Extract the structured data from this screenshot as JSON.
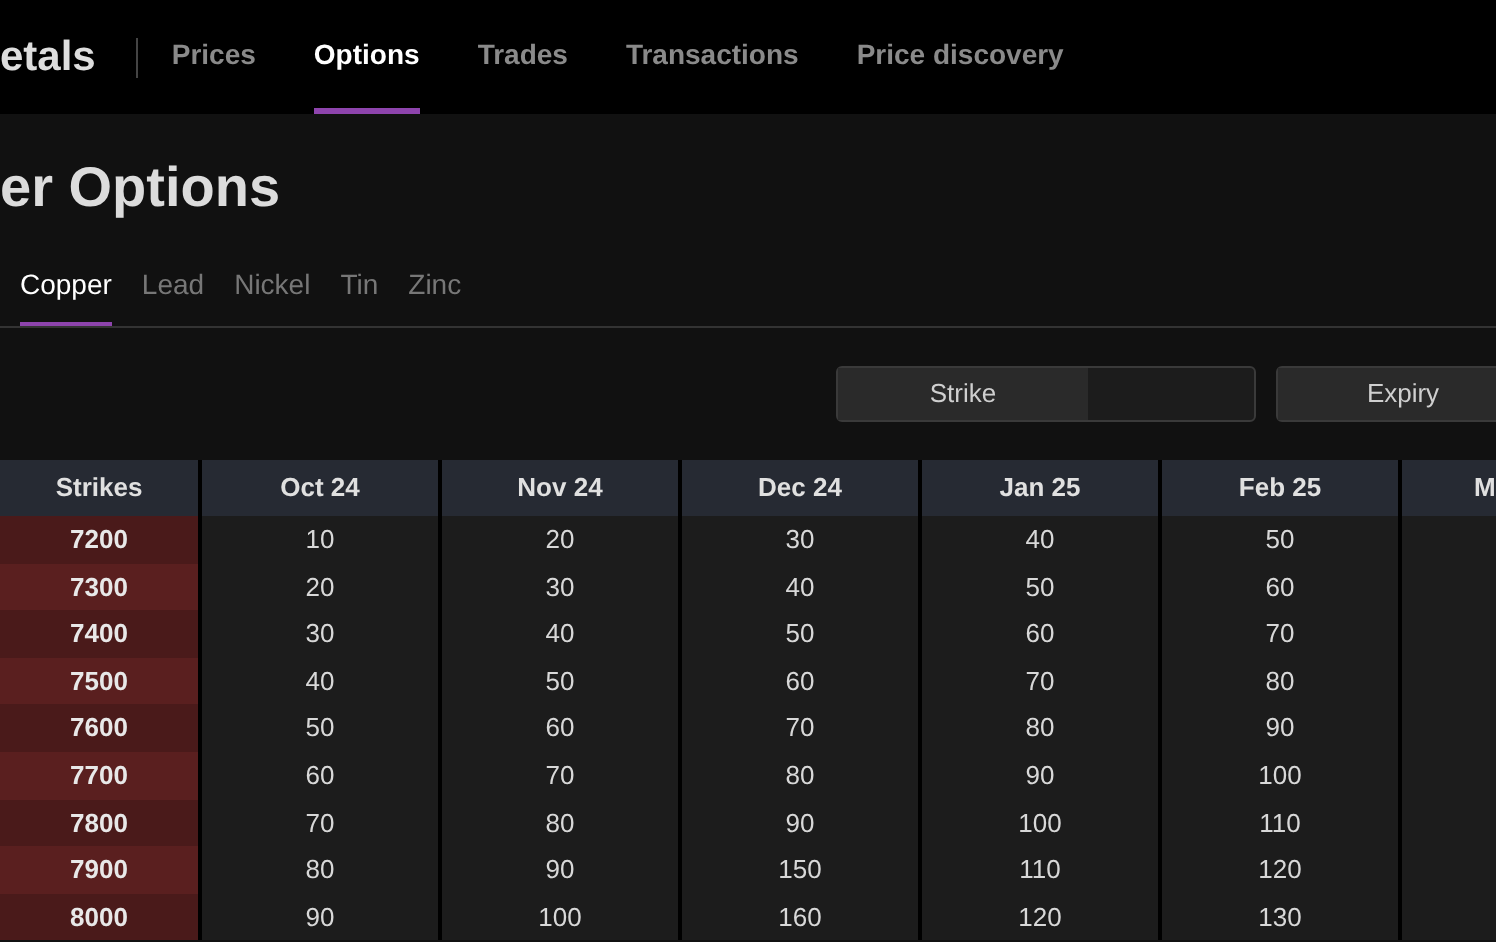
{
  "header": {
    "brand": "etals",
    "nav": [
      {
        "label": "Prices",
        "selected": false
      },
      {
        "label": "Options",
        "selected": true
      },
      {
        "label": "Trades",
        "selected": false
      },
      {
        "label": "Transactions",
        "selected": false
      },
      {
        "label": "Price discovery",
        "selected": false
      }
    ]
  },
  "title": "er Options",
  "metal_tabs": [
    {
      "label": "Copper",
      "selected": true
    },
    {
      "label": "Lead",
      "selected": false
    },
    {
      "label": "Nickel",
      "selected": false
    },
    {
      "label": "Tin",
      "selected": false
    },
    {
      "label": "Zinc",
      "selected": false
    }
  ],
  "toggles": [
    {
      "label": "Strike"
    },
    {
      "label": "Expiry"
    }
  ],
  "table": {
    "columns": [
      "Strikes",
      "Oct 24",
      "Nov 24",
      "Dec 24",
      "Jan 25",
      "Feb 25",
      "M"
    ],
    "rows": [
      {
        "strike": "7200",
        "values": [
          "10",
          "20",
          "30",
          "40",
          "50"
        ]
      },
      {
        "strike": "7300",
        "values": [
          "20",
          "30",
          "40",
          "50",
          "60"
        ]
      },
      {
        "strike": "7400",
        "values": [
          "30",
          "40",
          "50",
          "60",
          "70"
        ]
      },
      {
        "strike": "7500",
        "values": [
          "40",
          "50",
          "60",
          "70",
          "80"
        ]
      },
      {
        "strike": "7600",
        "values": [
          "50",
          "60",
          "70",
          "80",
          "90"
        ]
      },
      {
        "strike": "7700",
        "values": [
          "60",
          "70",
          "80",
          "90",
          "100"
        ]
      },
      {
        "strike": "7800",
        "values": [
          "70",
          "80",
          "90",
          "100",
          "110"
        ]
      },
      {
        "strike": "7900",
        "values": [
          "80",
          "90",
          "150",
          "110",
          "120"
        ]
      },
      {
        "strike": "8000",
        "values": [
          "90",
          "100",
          "160",
          "120",
          "130"
        ]
      }
    ]
  }
}
